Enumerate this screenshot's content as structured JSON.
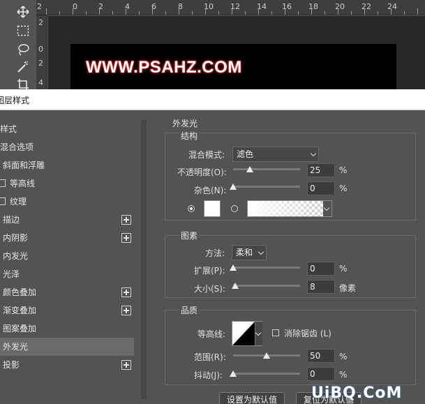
{
  "workspace": {
    "ruler_top_labels": [
      "2",
      "0",
      "2",
      "4",
      "6",
      "8",
      "10",
      "12",
      "14",
      "16",
      "18",
      "20",
      "22",
      "24"
    ],
    "ruler_left_labels": [
      "2",
      "0",
      "2",
      "4"
    ],
    "canvas_text": "WWW.PSAHZ.COM",
    "tools": [
      "move-icon",
      "marquee-icon",
      "lasso-icon",
      "magic-wand-icon",
      "crop-icon"
    ]
  },
  "dialog": {
    "title": "图层样式",
    "style_list": [
      {
        "label": "样式",
        "has_check": false,
        "has_plus": false,
        "active": false
      },
      {
        "label": "混合选项",
        "has_check": false,
        "has_plus": false,
        "active": false
      },
      {
        "label": "斜面和浮雕",
        "has_check": false,
        "has_plus": false,
        "active": false
      },
      {
        "label": "等高线",
        "has_check": true,
        "has_plus": false,
        "active": false
      },
      {
        "label": "纹理",
        "has_check": true,
        "has_plus": false,
        "active": false
      },
      {
        "label": "描边",
        "has_check": false,
        "has_plus": true,
        "active": false
      },
      {
        "label": "内阴影",
        "has_check": false,
        "has_plus": true,
        "active": false
      },
      {
        "label": "内发光",
        "has_check": false,
        "has_plus": false,
        "active": false
      },
      {
        "label": "光泽",
        "has_check": false,
        "has_plus": false,
        "active": false
      },
      {
        "label": "颜色叠加",
        "has_check": false,
        "has_plus": true,
        "active": false
      },
      {
        "label": "渐变叠加",
        "has_check": false,
        "has_plus": true,
        "active": false
      },
      {
        "label": "图案叠加",
        "has_check": false,
        "has_plus": false,
        "active": false
      },
      {
        "label": "外发光",
        "has_check": false,
        "has_plus": false,
        "active": true
      },
      {
        "label": "投影",
        "has_check": false,
        "has_plus": true,
        "active": false
      }
    ],
    "panel": {
      "title": "外发光",
      "structure": {
        "label": "结构",
        "blend_mode_label": "混合模式:",
        "blend_mode_value": "滤色",
        "opacity_label": "不透明度(O):",
        "opacity_value": "25",
        "opacity_unit": "%",
        "opacity_fraction": 0.25,
        "noise_label": "杂色(N):",
        "noise_value": "0",
        "noise_unit": "%",
        "noise_fraction": 0.0,
        "glow_color": "#ffffff",
        "color_mode": "solid"
      },
      "elements": {
        "label": "图素",
        "technique_label": "方法:",
        "technique_value": "柔和",
        "spread_label": "扩展(P):",
        "spread_value": "0",
        "spread_unit": "%",
        "spread_fraction": 0.0,
        "size_label": "大小(S):",
        "size_value": "8",
        "size_unit": "像素",
        "size_fraction": 0.032
      },
      "quality": {
        "label": "品质",
        "contour_label": "等高线:",
        "antialias_label": "消除锯齿 (L)",
        "antialias_checked": false,
        "range_label": "范围(R):",
        "range_value": "50",
        "range_unit": "%",
        "range_fraction": 0.5,
        "jitter_label": "抖动(J):",
        "jitter_value": "0",
        "jitter_unit": "%",
        "jitter_fraction": 0.0
      },
      "buttons": {
        "set_default": "设置为默认值",
        "reset_default": "复位为默认值"
      }
    }
  },
  "watermark": "UiBQ.CoM",
  "colors": {
    "panel_bg": "#535353",
    "active_item": "#6a6a6a",
    "glow": "#ff2020"
  }
}
